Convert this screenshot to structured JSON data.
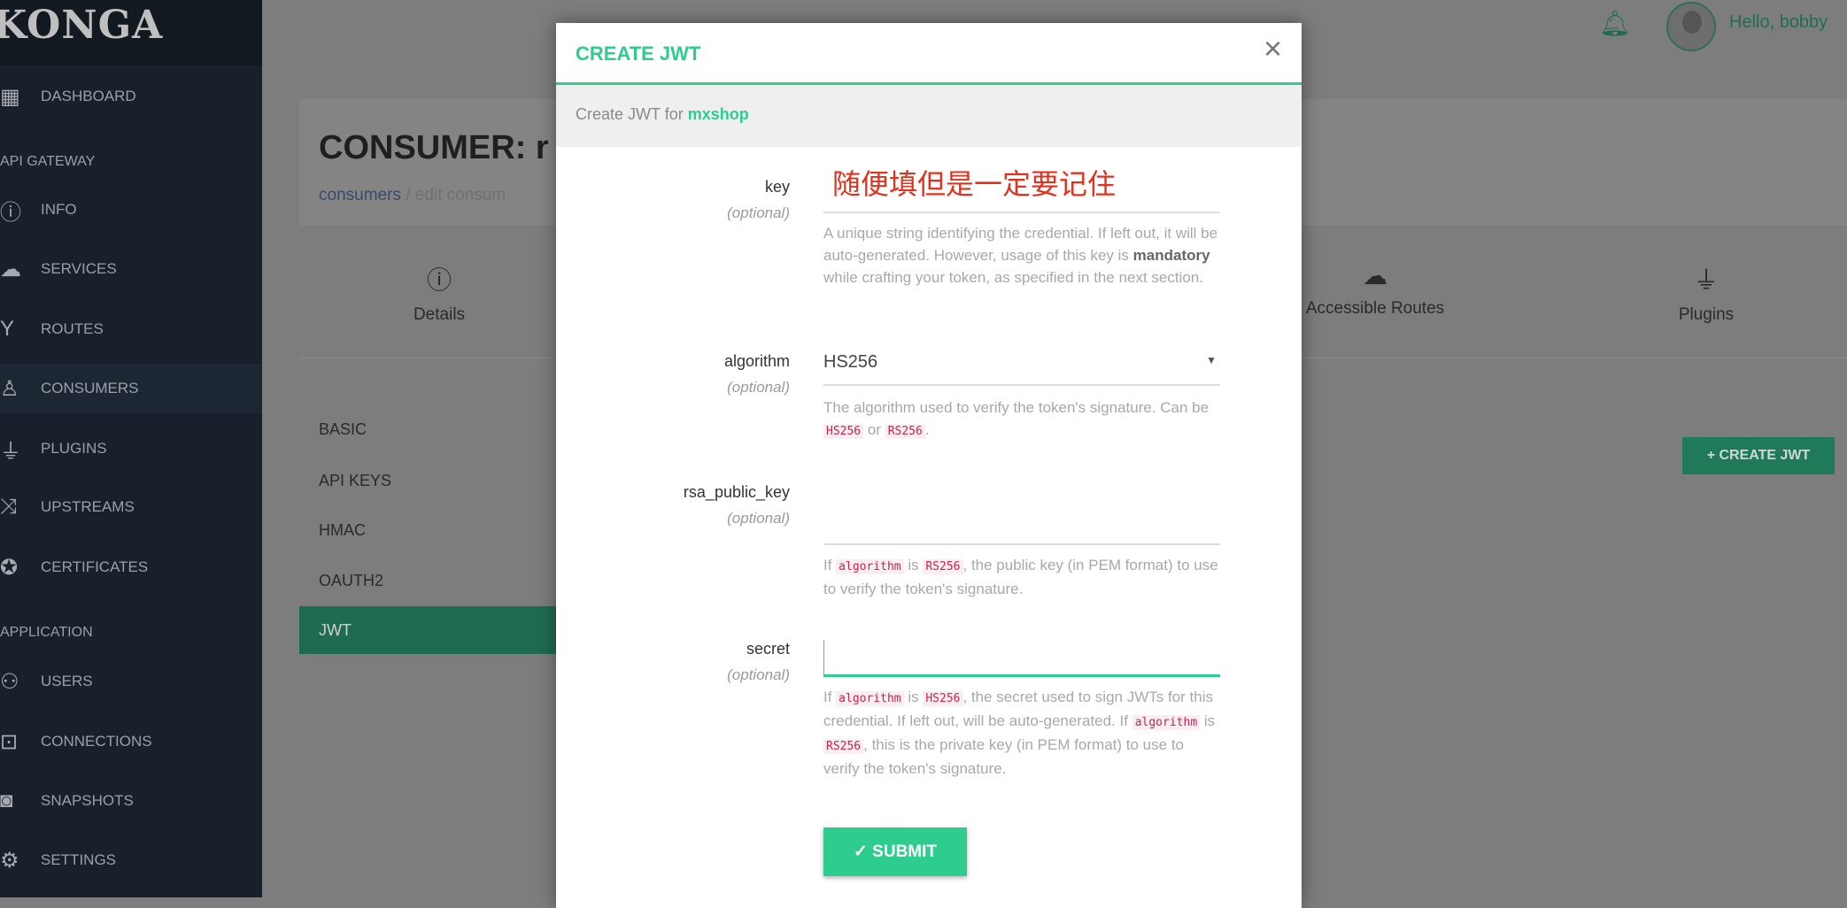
{
  "app": {
    "logo": "KONGA"
  },
  "sidebar": {
    "items": [
      {
        "label": "DASHBOARD",
        "icon": "dashboard-icon"
      },
      {
        "label": "INFO",
        "icon": "info-icon"
      },
      {
        "label": "SERVICES",
        "icon": "cloud-icon"
      },
      {
        "label": "ROUTES",
        "icon": "routes-icon"
      },
      {
        "label": "CONSUMERS",
        "icon": "user-icon"
      },
      {
        "label": "PLUGINS",
        "icon": "plug-icon"
      },
      {
        "label": "UPSTREAMS",
        "icon": "shuffle-icon"
      },
      {
        "label": "CERTIFICATES",
        "icon": "certificate-icon"
      },
      {
        "label": "USERS",
        "icon": "users-icon"
      },
      {
        "label": "CONNECTIONS",
        "icon": "cast-icon"
      },
      {
        "label": "SNAPSHOTS",
        "icon": "camera-icon"
      },
      {
        "label": "SETTINGS",
        "icon": "gear-icon"
      }
    ],
    "sections": {
      "api_gateway": "API GATEWAY",
      "application": "APPLICATION"
    }
  },
  "topbar": {
    "greeting": "Hello, bobby"
  },
  "page": {
    "title": "CONSUMER: r",
    "breadcrumb": {
      "link": "consumers",
      "current": "/ edit consum"
    },
    "tabs": [
      {
        "label": "Details"
      },
      {
        "label": "Accessible Routes"
      },
      {
        "label": "Plugins"
      }
    ],
    "credential_tabs": [
      "BASIC",
      "API KEYS",
      "HMAC",
      "OAUTH2",
      "JWT"
    ],
    "create_button": "+ CREATE JWT"
  },
  "modal": {
    "title": "CREATE JWT",
    "subtitle_prefix": "Create JWT for",
    "consumer": "mxshop",
    "optional": "(optional)",
    "key": {
      "label": "key",
      "annotation": "随便填但是一定要记住",
      "help1": "A unique string identifying the credential. If left out, it will be auto-generated. However, usage of this key is ",
      "help_bold": "mandatory",
      "help2": " while crafting your token, as specified in the next section."
    },
    "algorithm": {
      "label": "algorithm",
      "value": "HS256",
      "help1": "The algorithm used to verify the token's signature. Can be ",
      "code1": "HS256",
      "help2": " or ",
      "code2": "RS256",
      "help3": "."
    },
    "rsa_public_key": {
      "label": "rsa_public_key",
      "help1": "If ",
      "code1": "algorithm",
      "help2": " is ",
      "code2": "RS256",
      "help3": ", the public key (in PEM format) to use to verify the token's signature."
    },
    "secret": {
      "label": "secret",
      "value": "",
      "help1": "If ",
      "code1": "algorithm",
      "help2": " is ",
      "code2": "HS256",
      "help3": ", the secret used to sign JWTs for this credential. If left out, will be auto-generated. If ",
      "code3": "algorithm",
      "help4": " is ",
      "code4": "RS256",
      "help5": ", this is the private key (in PEM format) to use to verify the token's signature."
    },
    "submit": "✓ SUBMIT"
  },
  "colors": {
    "accent": "#2ecc8f",
    "annotation": "#e0321e",
    "sidebar": "#18202b"
  }
}
